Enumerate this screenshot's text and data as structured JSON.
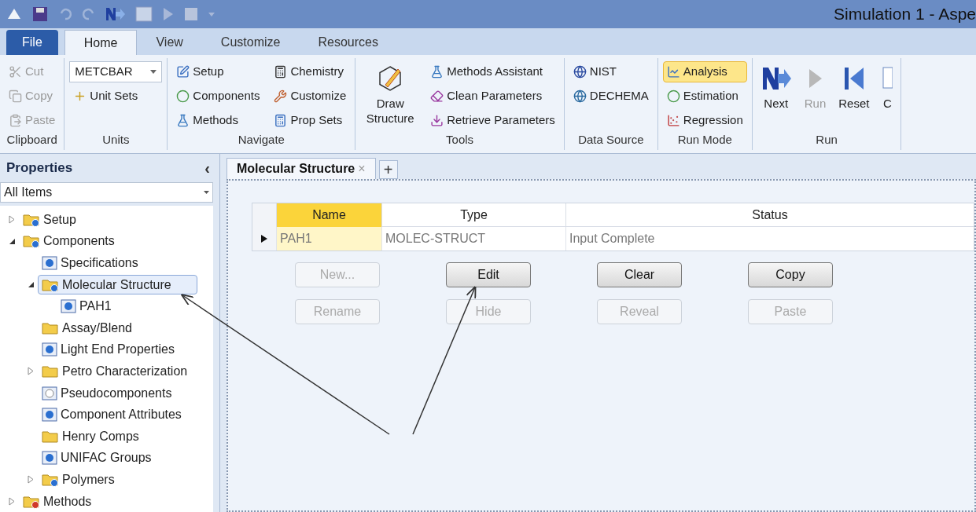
{
  "window": {
    "title": "Simulation 1 - Aspe"
  },
  "ribbon_tabs": [
    {
      "label": "File",
      "kind": "file",
      "selected": false
    },
    {
      "label": "Home",
      "kind": "tab",
      "selected": true
    },
    {
      "label": "View",
      "kind": "tab",
      "selected": false
    },
    {
      "label": "Customize",
      "kind": "tab",
      "selected": false
    },
    {
      "label": "Resources",
      "kind": "tab",
      "selected": false
    }
  ],
  "ribbon_groups": [
    {
      "label": "Clipboard",
      "items": [
        {
          "label": "Cut",
          "kind": "small",
          "disabled": true
        },
        {
          "label": "Copy",
          "kind": "small",
          "disabled": true
        },
        {
          "label": "Paste",
          "kind": "small",
          "disabled": true
        }
      ]
    },
    {
      "label": "Units",
      "items": [
        {
          "value": "METCBAR",
          "kind": "dropdown",
          "disabled": false
        },
        {
          "label": "Unit Sets",
          "kind": "small",
          "disabled": false
        }
      ]
    },
    {
      "label": "Navigate",
      "items": [
        {
          "label": "Setup",
          "kind": "small",
          "disabled": false
        },
        {
          "label": "Components",
          "kind": "small",
          "disabled": false
        },
        {
          "label": "Methods",
          "kind": "small",
          "disabled": false
        },
        {
          "label": "Chemistry",
          "kind": "small",
          "disabled": false
        },
        {
          "label": "Customize",
          "kind": "small",
          "disabled": false
        },
        {
          "label": "Prop Sets",
          "kind": "small",
          "disabled": false
        }
      ]
    },
    {
      "label": "Tools",
      "items": [
        {
          "label": "Draw Structure",
          "kind": "large",
          "disabled": false
        },
        {
          "label": "Methods Assistant",
          "kind": "small",
          "disabled": false
        },
        {
          "label": "Clean Parameters",
          "kind": "small",
          "disabled": false
        },
        {
          "label": "Retrieve Parameters",
          "kind": "small",
          "disabled": false
        }
      ]
    },
    {
      "label": "Data Source",
      "items": [
        {
          "label": "NIST",
          "kind": "small",
          "disabled": false
        },
        {
          "label": "DECHEMA",
          "kind": "small",
          "disabled": false
        }
      ]
    },
    {
      "label": "Run Mode",
      "items": [
        {
          "label": "Analysis",
          "kind": "small",
          "disabled": false,
          "selected": true
        },
        {
          "label": "Estimation",
          "kind": "small",
          "disabled": false,
          "selected": false
        },
        {
          "label": "Regression",
          "kind": "small",
          "disabled": false,
          "selected": false
        }
      ]
    },
    {
      "label": "Run",
      "items": [
        {
          "label": "Next",
          "kind": "large",
          "disabled": false
        },
        {
          "label": "Run",
          "kind": "large",
          "disabled": true
        },
        {
          "label": "Reset",
          "kind": "large",
          "disabled": false
        },
        {
          "label": "C",
          "kind": "large",
          "disabled": false
        }
      ]
    }
  ],
  "sidebar": {
    "title": "Properties",
    "collapse": "‹",
    "filter": "All Items",
    "tree": [
      {
        "label": "Setup",
        "kind": "folder-check",
        "expanded": false,
        "selected": false
      },
      {
        "label": "Components",
        "kind": "folder-check",
        "expanded": true,
        "selected": false,
        "children": [
          {
            "label": "Specifications",
            "kind": "form-check",
            "selected": false
          },
          {
            "label": "Molecular Structure",
            "kind": "folder-check",
            "expanded": true,
            "selected": true,
            "children": [
              {
                "label": "PAH1",
                "kind": "form-check",
                "selected": false
              }
            ]
          },
          {
            "label": "Assay/Blend",
            "kind": "folder",
            "selected": false
          },
          {
            "label": "Light End Properties",
            "kind": "form-check",
            "selected": false
          },
          {
            "label": "Petro Characterization",
            "kind": "folder",
            "expanded": false,
            "selected": false
          },
          {
            "label": "Pseudocomponents",
            "kind": "form-empty",
            "selected": false
          },
          {
            "label": "Component Attributes",
            "kind": "form-check",
            "selected": false
          },
          {
            "label": "Henry Comps",
            "kind": "folder",
            "selected": false
          },
          {
            "label": "UNIFAC Groups",
            "kind": "form-check",
            "selected": false
          },
          {
            "label": "Polymers",
            "kind": "folder-check",
            "expanded": false,
            "selected": false
          }
        ]
      },
      {
        "label": "Methods",
        "kind": "folder-error",
        "expanded": false,
        "selected": false
      }
    ]
  },
  "document_tabs": [
    {
      "label": "Molecular Structure",
      "close": "×",
      "selected": true
    }
  ],
  "new_tab": "+",
  "table": {
    "columns": [
      "Name",
      "Type",
      "Status"
    ],
    "rows": [
      {
        "selected": true,
        "cells": [
          "PAH1",
          "MOLEC-STRUCT",
          "Input Complete"
        ]
      }
    ]
  },
  "buttons": [
    [
      {
        "label": "New...",
        "disabled": true
      },
      {
        "label": "Edit",
        "disabled": false
      },
      {
        "label": "Clear",
        "disabled": false
      },
      {
        "label": "Copy",
        "disabled": false
      }
    ],
    [
      {
        "label": "Rename",
        "disabled": true
      },
      {
        "label": "Hide",
        "disabled": true
      },
      {
        "label": "Reveal",
        "disabled": true
      },
      {
        "label": "Paste",
        "disabled": true
      }
    ]
  ]
}
